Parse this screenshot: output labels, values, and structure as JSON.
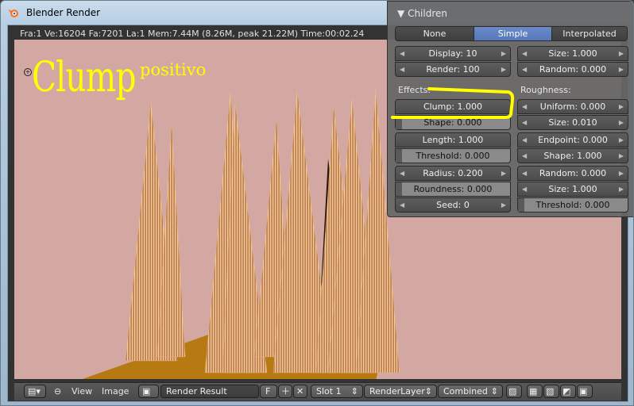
{
  "window": {
    "title": "Blender Render"
  },
  "statusline": "Fra:1  Ve:16204 Fa:7201 La:1 Mem:7.44M (8.26M, peak 21.22M) Time:00:02.24",
  "overlay": {
    "title": "Clump",
    "subtitle": "positivo",
    "color": "#ffff00"
  },
  "panel": {
    "title": "Children",
    "modes": [
      "None",
      "Simple",
      "Interpolated"
    ],
    "active_mode": "Simple",
    "display": "Display: 10",
    "render": "Render: 100",
    "size": "Size: 1.000",
    "random": "Random: 0.000",
    "effects_label": "Effects:",
    "roughness_label": "Roughness:",
    "clump": "Clump: 1.000",
    "shape": "Shape: 0.000",
    "length": "Length: 1.000",
    "threshold": "Threshold: 0.000",
    "radius": "Radius: 0.200",
    "roundness": "Roundness: 0.000",
    "seed": "Seed: 0",
    "uniform": "Uniform: 0.000",
    "rough_size": "Size: 0.010",
    "endpoint": "Endpoint: 0.000",
    "end_shape": "Shape: 1.000",
    "rough_random": "Random: 0.000",
    "rough_random_size": "Size: 1.000",
    "rough_threshold": "Threshold: 0.000",
    "accent": "#5578bc",
    "highlight_color": "#ffff00"
  },
  "header": {
    "view": "View",
    "image": "Image",
    "image_name": "Render Result",
    "fake_user": "F",
    "slot": "Slot 1",
    "layer": "RenderLayer",
    "pass": "Combined"
  }
}
